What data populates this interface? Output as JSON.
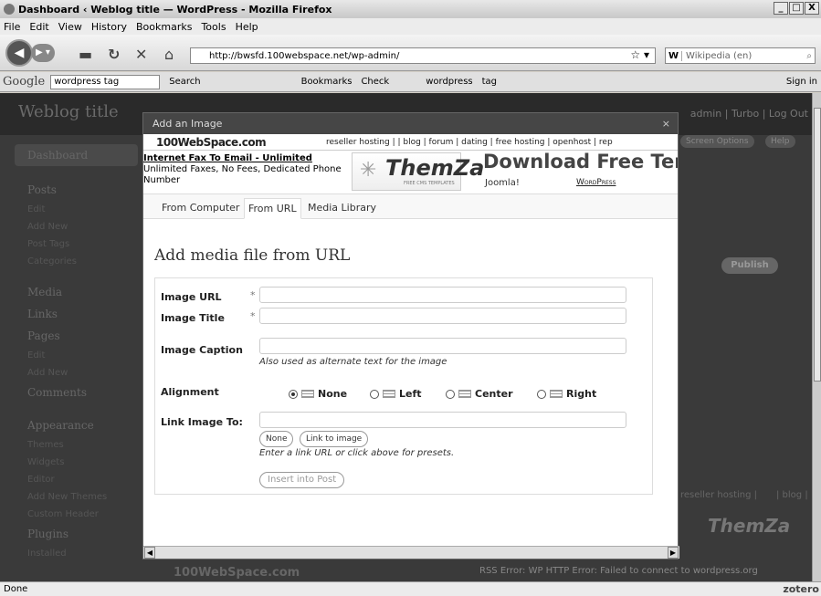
{
  "window": {
    "title": "Dashboard ‹ Weblog title — WordPress - Mozilla Firefox",
    "controls": [
      "_",
      "□",
      "X"
    ]
  },
  "menu": [
    "File",
    "Edit",
    "View",
    "History",
    "Bookmarks",
    "Tools",
    "Help"
  ],
  "nav": {
    "url": "http://bwsfd.100webspace.net/wp-admin/",
    "search_engine": "W",
    "search_placeholder": "Wikipedia (en)"
  },
  "google_toolbar": {
    "logo": "Google",
    "query": "wordpress tag",
    "items": [
      "Search",
      "Bookmarks",
      "Check",
      "wordpress",
      "tag",
      "Sign in"
    ]
  },
  "wp": {
    "site_title": "Weblog title",
    "user_links": "admin | Turbo | Log Out",
    "screen_options": "Screen Options",
    "help": "Help",
    "publish": "Publish",
    "sidebar": [
      {
        "label": "Dashboard",
        "type": "main"
      },
      {
        "label": "Posts",
        "type": "main"
      },
      {
        "label": "Edit",
        "type": "sub"
      },
      {
        "label": "Add New",
        "type": "sub"
      },
      {
        "label": "Post Tags",
        "type": "sub"
      },
      {
        "label": "Categories",
        "type": "sub"
      },
      {
        "label": "Media",
        "type": "main"
      },
      {
        "label": "Links",
        "type": "main"
      },
      {
        "label": "Pages",
        "type": "main"
      },
      {
        "label": "Edit",
        "type": "sub"
      },
      {
        "label": "Add New",
        "type": "sub"
      },
      {
        "label": "Comments",
        "type": "main"
      },
      {
        "label": "Appearance",
        "type": "main"
      },
      {
        "label": "Themes",
        "type": "sub"
      },
      {
        "label": "Widgets",
        "type": "sub"
      },
      {
        "label": "Editor",
        "type": "sub"
      },
      {
        "label": "Add New Themes",
        "type": "sub"
      },
      {
        "label": "Custom Header",
        "type": "sub"
      },
      {
        "label": "Plugins",
        "type": "main"
      },
      {
        "label": "Installed",
        "type": "sub"
      }
    ],
    "bg_ad": "reseller hosting |",
    "bg_ad2": "| blog |",
    "rss_error": "RSS Error: WP HTTP Error: Failed to connect to wordpress.org",
    "bg_logo": "100WebSpace.com",
    "bg_themza": "ThemZa"
  },
  "modal": {
    "title": "Add an Image",
    "close": "×",
    "ad": {
      "logo": "100WebSpace.com",
      "links": "reseller hosting |          | blog | forum | dating | free hosting | openhost | rep"
    },
    "banner": {
      "fax_link": "Internet Fax To Email - Unlimited",
      "fax_desc": "Unlimited Faxes, No Fees, Dedicated Phone Number",
      "themza": "ThemZa",
      "themza_sub": "FREE CMS TEMPLATES",
      "download": "Download Free Temp",
      "joomla": "Joomla!",
      "wordpress": "WordPress"
    },
    "tabs": [
      "From Computer",
      "From URL",
      "Media Library"
    ],
    "heading": "Add media file from URL",
    "form": {
      "image_url": "Image URL",
      "image_title": "Image Title",
      "image_caption": "Image Caption",
      "caption_hint": "Also used as alternate text for the image",
      "alignment": "Alignment",
      "align_options": [
        "None",
        "Left",
        "Center",
        "Right"
      ],
      "link_to": "Link Image To:",
      "none_btn": "None",
      "link_btn": "Link to image",
      "link_hint": "Enter a link URL or click above for presets.",
      "insert": "Insert into Post",
      "required": "*"
    }
  },
  "status": {
    "text": "Done",
    "zotero": "zotero"
  }
}
